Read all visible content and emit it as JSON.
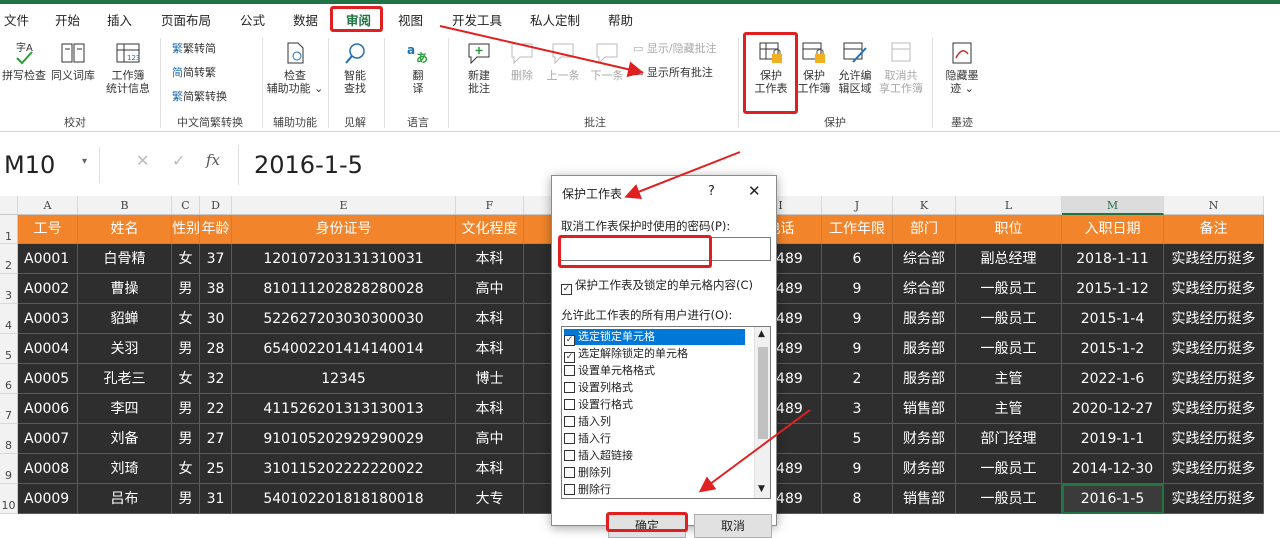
{
  "tabs": [
    "文件",
    "开始",
    "插入",
    "页面布局",
    "公式",
    "数据",
    "审阅",
    "视图",
    "开发工具",
    "私人定制",
    "帮助"
  ],
  "ribbon": {
    "spell": "拼写检查",
    "thesaurus": "同义词库",
    "wbstats1": "工作簿",
    "wbstats2": "统计信息",
    "grp_proof": "校对",
    "t2s": "繁转简",
    "s2t": "简转繁",
    "conv": "简繁转换",
    "grp_cn": "中文简繁转换",
    "acc1": "检查",
    "acc2": "辅助功能 ⌄",
    "grp_acc": "辅助功能",
    "smart1": "智能",
    "smart2": "查找",
    "grp_insight": "见解",
    "tr1": "翻",
    "tr2": "译",
    "grp_lang": "语言",
    "newc1": "新建",
    "newc2": "批注",
    "del": "删除",
    "prev": "上一条",
    "next": "下一条",
    "showhide": "显示/隐藏批注",
    "showall": "显示所有批注",
    "grp_comments": "批注",
    "ps1": "保护",
    "ps2": "工作表",
    "pw1": "保护",
    "pw2": "工作簿",
    "ae1": "允许编",
    "ae2": "辑区域",
    "us1": "取消共",
    "us2": "享工作簿",
    "grp_protect": "保护",
    "ink1": "隐藏墨",
    "ink2": "迹 ⌄",
    "grp_ink": "墨迹"
  },
  "namebox": "M10",
  "formula": "2016-1-5",
  "columns": [
    "A",
    "B",
    "C",
    "D",
    "E",
    "F",
    "G",
    "H",
    "I",
    "J",
    "K",
    "L",
    "M",
    "N"
  ],
  "rows": [
    "1",
    "2",
    "3",
    "4",
    "5",
    "6",
    "7",
    "8",
    "9",
    "10"
  ],
  "headers": [
    "工号",
    "姓名",
    "性别",
    "年龄",
    "身份证号",
    "文化程度",
    "",
    "",
    "电话",
    "工作年限",
    "部门",
    "职位",
    "入职日期",
    "备注"
  ],
  "data": [
    [
      "A0001",
      "白骨精",
      "女",
      "37",
      "120107203131310031",
      "本科",
      "",
      "",
      "75489",
      "6",
      "综合部",
      "副总经理",
      "2018-1-11",
      "实践经历挺多"
    ],
    [
      "A0002",
      "曹操",
      "男",
      "38",
      "810111202828280028",
      "高中",
      "浙",
      "",
      "75489",
      "9",
      "综合部",
      "一般员工",
      "2015-1-12",
      "实践经历挺多"
    ],
    [
      "A0003",
      "貂蝉",
      "女",
      "30",
      "522627203030300030",
      "本科",
      "浙",
      "",
      "75489",
      "9",
      "服务部",
      "一般员工",
      "2015-1-4",
      "实践经历挺多"
    ],
    [
      "A0004",
      "关羽",
      "男",
      "28",
      "654002201414140014",
      "本科",
      "浙",
      "",
      "75489",
      "9",
      "服务部",
      "一般员工",
      "2015-1-2",
      "实践经历挺多"
    ],
    [
      "A0005",
      "孔老三",
      "女",
      "32",
      "12345",
      "博士",
      "",
      "",
      "75489",
      "2",
      "服务部",
      "主管",
      "2022-1-6",
      "实践经历挺多"
    ],
    [
      "A0006",
      "李四",
      "男",
      "22",
      "411526201313130013",
      "本科",
      "浙",
      "",
      "75489",
      "3",
      "销售部",
      "主管",
      "2020-12-27",
      "实践经历挺多"
    ],
    [
      "A0007",
      "刘备",
      "男",
      "27",
      "910105202929290029",
      "高中",
      "",
      "",
      "",
      "5",
      "财务部",
      "部门经理",
      "2019-1-1",
      "实践经历挺多"
    ],
    [
      "A0008",
      "刘琦",
      "女",
      "25",
      "310115202222220022",
      "本科",
      "",
      "",
      "75489",
      "9",
      "财务部",
      "一般员工",
      "2014-12-30",
      "实践经历挺多"
    ],
    [
      "A0009",
      "吕布",
      "男",
      "31",
      "540102201818180018",
      "大专",
      "浙",
      "",
      "75489",
      "8",
      "销售部",
      "一般员工",
      "2016-1-5",
      "实践经历挺多"
    ]
  ],
  "dialog": {
    "title": "保护工作表",
    "help": "?",
    "close": "✕",
    "pwd_label": "取消工作表保护时使用的密码(P):",
    "protect_label": "保护工作表及锁定的单元格内容(C)",
    "allow_label": "允许此工作表的所有用户进行(O):",
    "perms": [
      "选定锁定单元格",
      "选定解除锁定的单元格",
      "设置单元格格式",
      "设置列格式",
      "设置行格式",
      "插入列",
      "插入行",
      "插入超链接",
      "删除列",
      "删除行"
    ],
    "perm_checked": [
      true,
      true,
      false,
      false,
      false,
      false,
      false,
      false,
      false,
      false
    ],
    "ok": "确定",
    "cancel": "取消"
  }
}
